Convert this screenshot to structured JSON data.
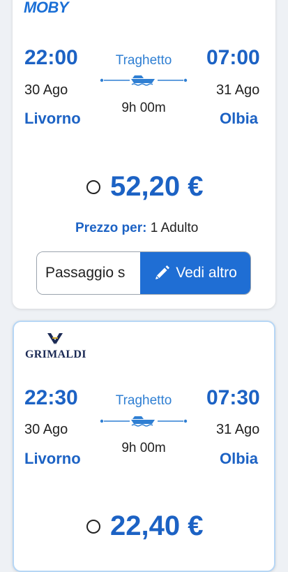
{
  "offers": [
    {
      "operator": "MOBY",
      "departure": {
        "time": "22:00",
        "date": "30 Ago",
        "city": "Livorno"
      },
      "arrival": {
        "time": "07:00",
        "date": "31 Ago",
        "city": "Olbia"
      },
      "mode": "Traghetto",
      "duration": "9h 00m",
      "price": "52,20 €",
      "per_label": "Prezzo per:",
      "per_value": "1 Adulto",
      "left_button": "Passaggio s",
      "right_button": "Vedi altro",
      "icons": [
        "ferry-icon",
        "pencil-icon"
      ]
    },
    {
      "operator": "GRIMALDI",
      "departure": {
        "time": "22:30",
        "date": "30 Ago",
        "city": "Livorno"
      },
      "arrival": {
        "time": "07:30",
        "date": "31 Ago",
        "city": "Olbia"
      },
      "mode": "Traghetto",
      "duration": "9h 00m",
      "price": "22,40 €"
    }
  ],
  "colors": {
    "accent": "#1c62c4",
    "button": "#1f6ed4",
    "text": "#222222"
  }
}
